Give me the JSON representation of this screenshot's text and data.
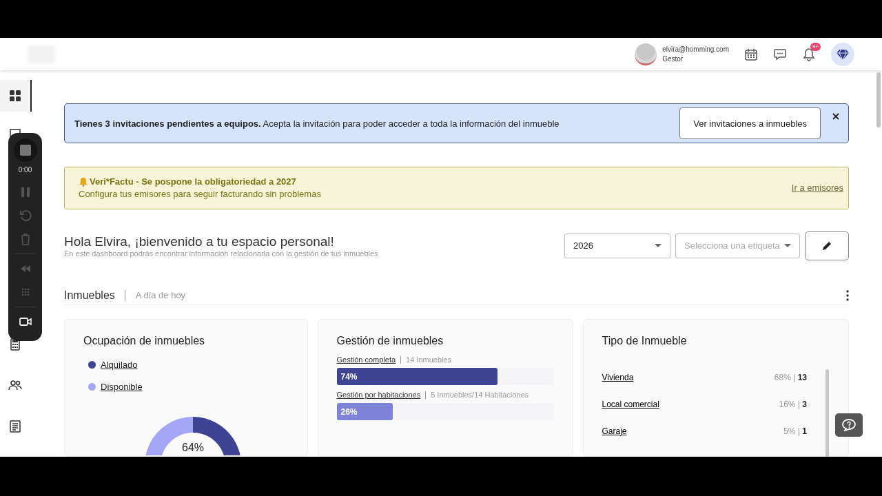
{
  "header": {
    "email": "elvira@homming.com",
    "role": "Gestor",
    "notification_badge": "9+"
  },
  "sidebar": {
    "items": [
      {
        "selected": true
      },
      {
        "selected": false
      },
      {
        "selected": false
      },
      {
        "selected": false
      },
      {
        "selected": false
      }
    ]
  },
  "recorder": {
    "time": "0:00"
  },
  "invitation_banner": {
    "message": "**Tienes 3 invitaciones pendientes a equipos.**  Acepta la invitación para poder acceder a toda la información del inmueble",
    "button": "Ver invitaciones a inmuebles"
  },
  "notice": {
    "title": "Veri*Factu - Se pospone la obligatoriedad a 2027",
    "message": "Configura tus emisores para seguir facturando sin problemas",
    "link": "Ir a emisores"
  },
  "welcome": {
    "title": "Hola Elvira, ¡bienvenido a tu espacio personal!",
    "subtitle": "En este dashboard podrás encontrar información relacionada con la gestión de tus inmuebles"
  },
  "filters": {
    "year": "2026",
    "tag_placeholder": "Selecciona una etiqueta"
  },
  "section": {
    "title": "Inmuebles",
    "subtitle": "A día de hoy"
  },
  "occupancy_card": {
    "title": "Ocupación de inmuebles",
    "legend": [
      {
        "label": "Alquilado",
        "color": "#3f4394"
      },
      {
        "label": "Disponible",
        "color": "#a5a6f6"
      }
    ],
    "reading": "64%"
  },
  "management_card": {
    "title": "Gestión de inmuebles",
    "rows": [
      {
        "label": "Gestión completa",
        "detail": "14 Inmuebles",
        "reading": "74%",
        "level": 0.74,
        "color": "#3f4394"
      },
      {
        "label": "Gestión por habitaciones",
        "detail": "5 Inmuebles/14 Habitaciones",
        "reading": "26%",
        "level": 0.26,
        "color": "#7f82d9"
      }
    ]
  },
  "type_card": {
    "title": "Tipo de Inmueble",
    "rows": [
      {
        "label": "Vivienda",
        "value": "68% | **13**"
      },
      {
        "label": "Local comercial",
        "value": "16% | **3**"
      },
      {
        "label": "Garaje",
        "value": "5% | **1**"
      }
    ]
  }
}
